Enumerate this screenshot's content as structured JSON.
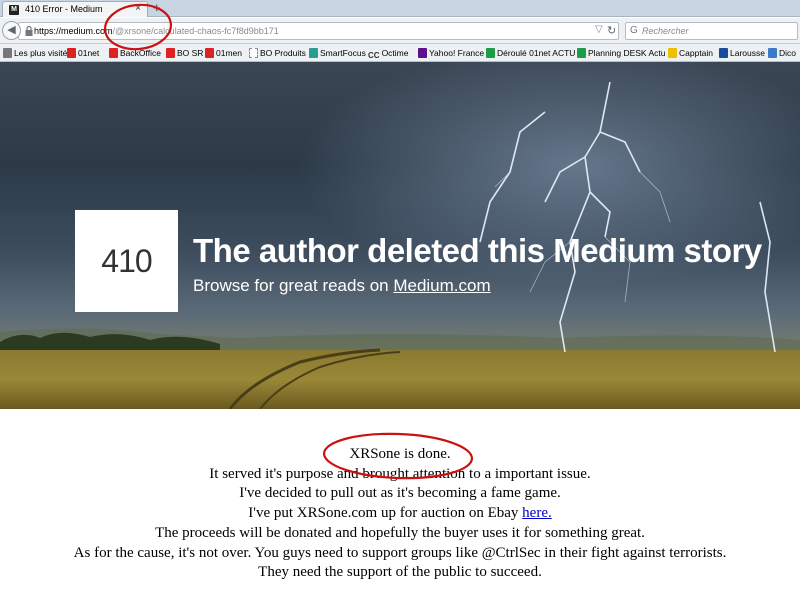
{
  "browser": {
    "tab_title": "410 Error - Medium",
    "new_tab_label": "+",
    "url_host": "https://medium.com",
    "url_path": "/@xrsone/calculated-chaos-fc7f8d9bb171",
    "search_placeholder": "Rechercher"
  },
  "bookmarks": [
    {
      "label": "Les plus visités",
      "icon": "gear-icon"
    },
    {
      "label": "01net",
      "icon": "01net-icon"
    },
    {
      "label": "BackOffice",
      "icon": "01net-icon"
    },
    {
      "label": "BO SR",
      "icon": "01net-icon"
    },
    {
      "label": "01men",
      "icon": "01net-icon"
    },
    {
      "label": "BO Produits",
      "icon": "page-icon"
    },
    {
      "label": "SmartFocus",
      "icon": "smartfocus-icon"
    },
    {
      "label": "Octime",
      "icon": "octime-icon"
    },
    {
      "label": "Yahoo! France",
      "icon": "yahoo-icon"
    },
    {
      "label": "Déroulé 01net ACTU",
      "icon": "sheet-icon"
    },
    {
      "label": "Planning DESK Actu",
      "icon": "sheet-icon"
    },
    {
      "label": "Capptain",
      "icon": "capptain-icon"
    },
    {
      "label": "Larousse",
      "icon": "larousse-icon"
    },
    {
      "label": "Dico",
      "icon": "dico-icon"
    }
  ],
  "hero": {
    "code": "410",
    "title": "The author deleted this Medium story",
    "subtitle_prefix": "Browse for great reads on ",
    "subtitle_link": "Medium.com"
  },
  "message": {
    "lines": [
      "XRSone is done.",
      "It served it's purpose and brought attention to a important issue.",
      "I've decided to pull out as it's becoming a fame game.",
      "I've put XRSone.com up for auction on Ebay ",
      "The proceeds will be donated and hopefully the buyer uses it for something great.",
      "As for the cause, it's not over. You guys need to support groups like @CtrlSec in their fight against terrorists.",
      "They need the support of the public to succeed."
    ],
    "link_text": "here."
  },
  "colors": {
    "annotation_red": "#cc1111",
    "link_blue": "#0000cc"
  }
}
